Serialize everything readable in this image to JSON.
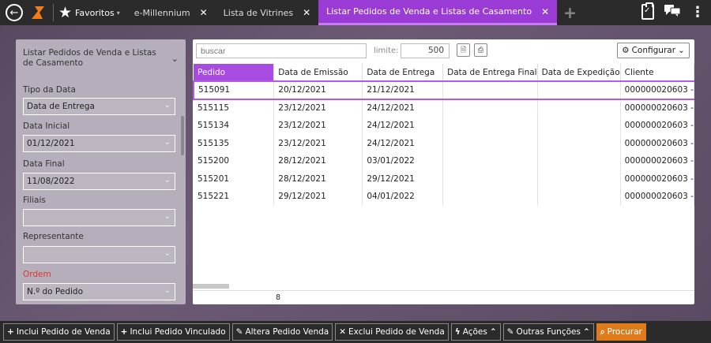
{
  "topbar": {
    "favorites_label": "Favoritos",
    "tabs": [
      {
        "label": "e-Millennium",
        "active": false
      },
      {
        "label": "Lista de Vitrines",
        "active": false
      },
      {
        "label": "Listar Pedidos de Venda e Listas de Casamento",
        "active": true
      }
    ],
    "accent_color": "#9b3bd6",
    "brand_color": "#f07d1a"
  },
  "filter": {
    "title": "Listar Pedidos de Venda e Listas de Casamento",
    "tipo_data_label": "Tipo da Data",
    "tipo_data_value": "Data de Entrega",
    "data_inicial_label": "Data Inicial",
    "data_inicial_value": "01/12/2021",
    "data_final_label": "Data Final",
    "data_final_value": "11/08/2022",
    "filiais_label": "Filiais",
    "filiais_value": "",
    "representante_label": "Representante",
    "representante_value": "",
    "ordem_label": "Ordem",
    "ordem_value": "N.º do Pedido"
  },
  "grid": {
    "search_placeholder": "buscar",
    "limit_label": "limite:",
    "limit_value": "500",
    "config_label": "Configurar",
    "columns": [
      "Pedido",
      "Data de Emissão",
      "Data de Entrega",
      "Data de Entrega Final",
      "Data de Expedição",
      "Cliente"
    ],
    "rows": [
      [
        "515091",
        "20/12/2021",
        "21/12/2021",
        "",
        "",
        "000000020603 -"
      ],
      [
        "515115",
        "23/12/2021",
        "24/12/2021",
        "",
        "",
        "000000020603 -"
      ],
      [
        "515134",
        "23/12/2021",
        "24/12/2021",
        "",
        "",
        "000000020603 -"
      ],
      [
        "515135",
        "23/12/2021",
        "24/12/2021",
        "",
        "",
        "000000020603 -"
      ],
      [
        "515200",
        "28/12/2021",
        "03/01/2022",
        "",
        "",
        "000000020603 -"
      ],
      [
        "515201",
        "28/12/2021",
        "29/12/2021",
        "",
        "",
        "000000020603 -"
      ],
      [
        "515221",
        "29/12/2021",
        "04/01/2022",
        "",
        "",
        "000000020603 -"
      ]
    ],
    "footer_count": "8"
  },
  "actions": {
    "inclui_pedido_venda": "Inclui Pedido de Venda",
    "inclui_pedido_vinculado": "Inclui Pedido Vinculado",
    "altera_pedido_venda": "Altera Pedido Venda",
    "exclui_pedido_venda": "Exclui Pedido de Venda",
    "acoes": "Ações",
    "outras_funcoes": "Outras Funções",
    "procurar": "Procurar"
  }
}
